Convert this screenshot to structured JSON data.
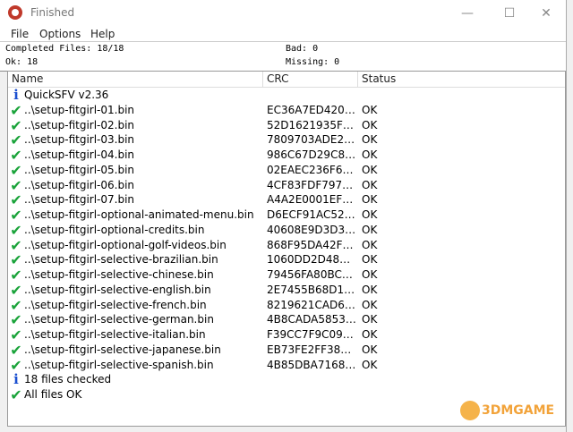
{
  "window": {
    "title": "Finished"
  },
  "menu": [
    "File",
    "Options",
    "Help"
  ],
  "stats": {
    "completed": "Completed Files: 18/18",
    "bad": "Bad: 0",
    "ok": "Ok: 18",
    "missing": "Missing: 0"
  },
  "columns": {
    "name": "Name",
    "crc": "CRC",
    "status": "Status"
  },
  "rows": [
    {
      "icon": "info",
      "name": "QuickSFV v2.36",
      "crc": "",
      "status": ""
    },
    {
      "icon": "check",
      "name": "..\\setup-fitgirl-01.bin",
      "crc": "EC36A7ED4203...",
      "status": "OK"
    },
    {
      "icon": "check",
      "name": "..\\setup-fitgirl-02.bin",
      "crc": "52D1621935F2C...",
      "status": "OK"
    },
    {
      "icon": "check",
      "name": "..\\setup-fitgirl-03.bin",
      "crc": "7809703ADE29...",
      "status": "OK"
    },
    {
      "icon": "check",
      "name": "..\\setup-fitgirl-04.bin",
      "crc": "986C67D29C84...",
      "status": "OK"
    },
    {
      "icon": "check",
      "name": "..\\setup-fitgirl-05.bin",
      "crc": "02EAEC236F68E...",
      "status": "OK"
    },
    {
      "icon": "check",
      "name": "..\\setup-fitgirl-06.bin",
      "crc": "4CF83FDF797A7...",
      "status": "OK"
    },
    {
      "icon": "check",
      "name": "..\\setup-fitgirl-07.bin",
      "crc": "A4A2E0001EF76...",
      "status": "OK"
    },
    {
      "icon": "check",
      "name": "..\\setup-fitgirl-optional-animated-menu.bin",
      "crc": "D6ECF91AC52F...",
      "status": "OK"
    },
    {
      "icon": "check",
      "name": "..\\setup-fitgirl-optional-credits.bin",
      "crc": "40608E9D3D3E...",
      "status": "OK"
    },
    {
      "icon": "check",
      "name": "..\\setup-fitgirl-optional-golf-videos.bin",
      "crc": "868F95DA42F4B...",
      "status": "OK"
    },
    {
      "icon": "check",
      "name": "..\\setup-fitgirl-selective-brazilian.bin",
      "crc": "1060DD2D48C7...",
      "status": "OK"
    },
    {
      "icon": "check",
      "name": "..\\setup-fitgirl-selective-chinese.bin",
      "crc": "79456FA80BC26...",
      "status": "OK"
    },
    {
      "icon": "check",
      "name": "..\\setup-fitgirl-selective-english.bin",
      "crc": "2E7455B68D1A...",
      "status": "OK"
    },
    {
      "icon": "check",
      "name": "..\\setup-fitgirl-selective-french.bin",
      "crc": "8219621CAD6D...",
      "status": "OK"
    },
    {
      "icon": "check",
      "name": "..\\setup-fitgirl-selective-german.bin",
      "crc": "4B8CADA58536...",
      "status": "OK"
    },
    {
      "icon": "check",
      "name": "..\\setup-fitgirl-selective-italian.bin",
      "crc": "F39CC7F9C09B8...",
      "status": "OK"
    },
    {
      "icon": "check",
      "name": "..\\setup-fitgirl-selective-japanese.bin",
      "crc": "EB73FE2FF3881...",
      "status": "OK"
    },
    {
      "icon": "check",
      "name": "..\\setup-fitgirl-selective-spanish.bin",
      "crc": "4B85DBA71683...",
      "status": "OK"
    },
    {
      "icon": "info",
      "name": "18 files checked",
      "crc": "",
      "status": ""
    },
    {
      "icon": "check",
      "name": "All files OK",
      "crc": "",
      "status": ""
    }
  ],
  "watermark": "3DMGAME",
  "colors": {
    "check": "#1aa33a",
    "info": "#1a4fd0"
  }
}
